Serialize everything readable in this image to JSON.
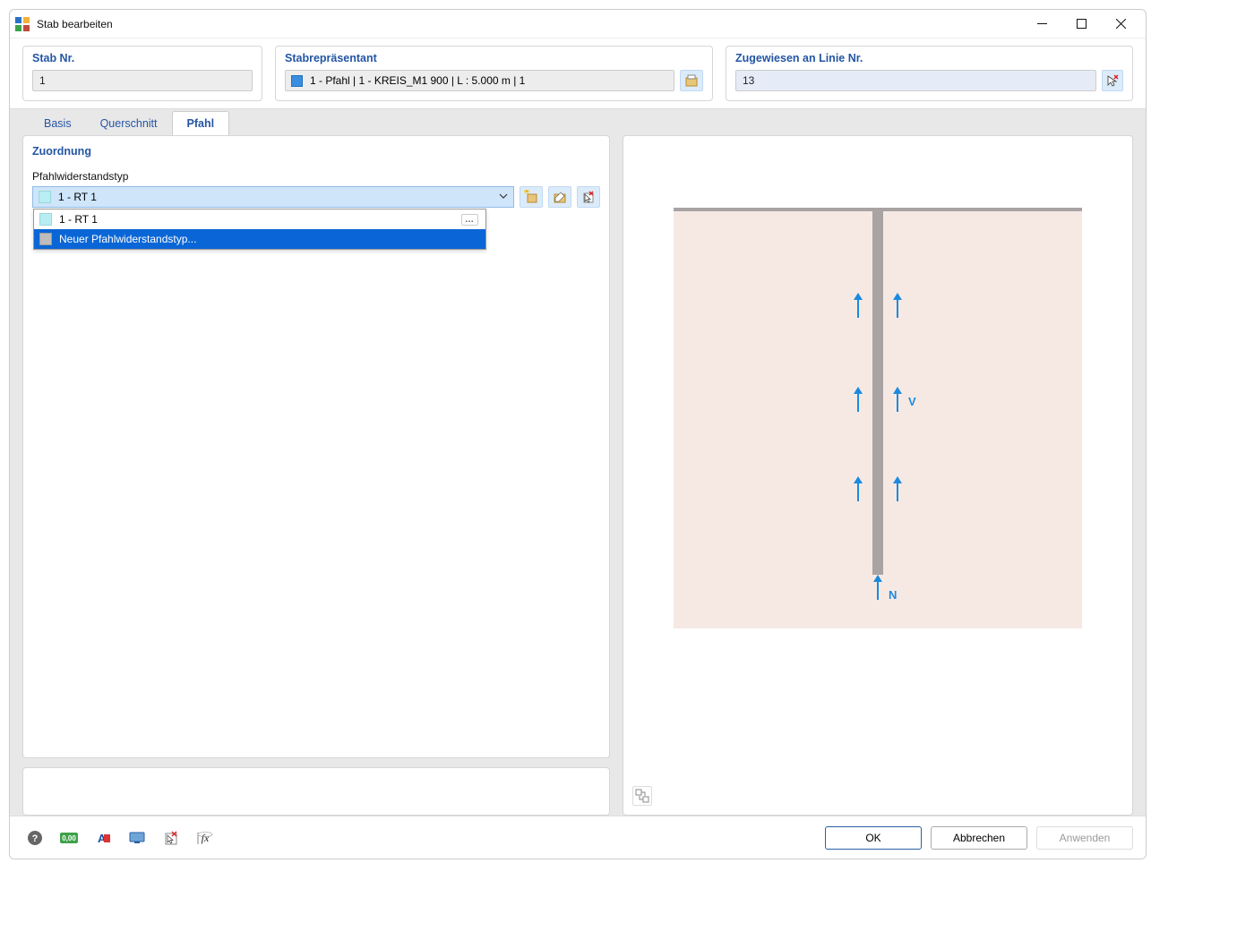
{
  "window": {
    "title": "Stab bearbeiten"
  },
  "header": {
    "stabnr_label": "Stab Nr.",
    "stabnr_value": "1",
    "rep_label": "Stabrepräsentant",
    "rep_value": "1 - Pfahl | 1 - KREIS_M1 900 | L : 5.000 m | 1",
    "line_label": "Zugewiesen an Linie Nr.",
    "line_value": "13"
  },
  "tabs": [
    {
      "id": "basis",
      "label": "Basis"
    },
    {
      "id": "querschnitt",
      "label": "Querschnitt"
    },
    {
      "id": "pfahl",
      "label": "Pfahl",
      "active": true
    }
  ],
  "zuordnung": {
    "section_title": "Zuordnung",
    "field_label": "Pfahlwiderstandstyp",
    "selected": "1 - RT 1",
    "options": [
      {
        "label": "1 - RT 1",
        "swatch": "#b8edf3"
      },
      {
        "label": "Neuer Pfahlwiderstandstyp...",
        "swatch": "#bbbbbb",
        "highlight": true
      }
    ]
  },
  "diagram": {
    "label_v": "V",
    "label_n": "N"
  },
  "buttons": {
    "ok": "OK",
    "cancel": "Abbrechen",
    "apply": "Anwenden"
  },
  "icons": {
    "new": "new-icon",
    "edit": "edit-icon",
    "delete": "delete-pick-icon",
    "pick": "pick-cursor-icon",
    "library": "library-icon"
  }
}
